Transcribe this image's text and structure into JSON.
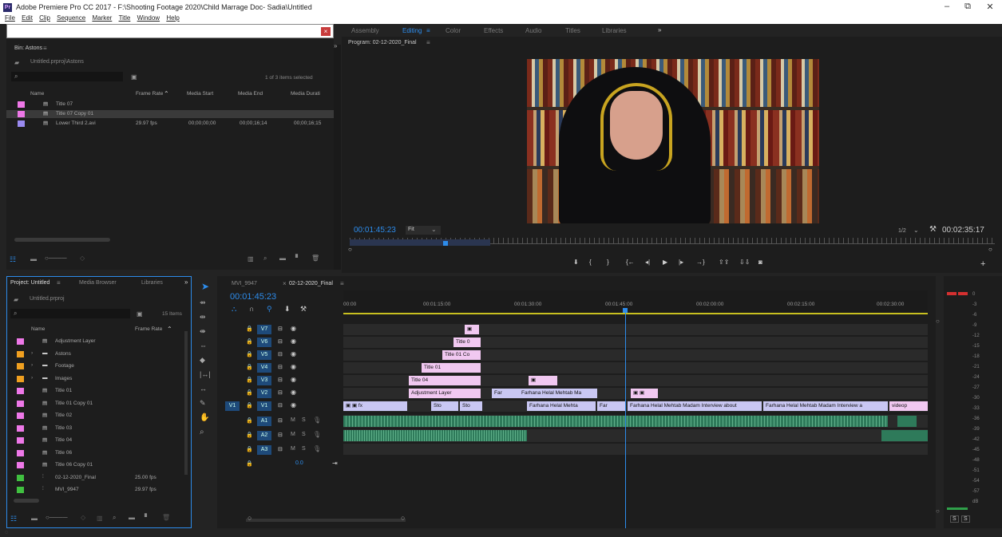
{
  "window": {
    "title": "Adobe Premiere Pro CC 2017 - F:\\Shooting Footage 2020\\Child Marrage Doc- Sadia\\Untitled",
    "minimize": "–",
    "restore": "⧉",
    "close": "✕"
  },
  "menu": [
    "File",
    "Edit",
    "Clip",
    "Sequence",
    "Marker",
    "Title",
    "Window",
    "Help"
  ],
  "workspaces": [
    "Assembly",
    "Editing",
    "Color",
    "Effects",
    "Audio",
    "Titles",
    "Libraries"
  ],
  "workspace_more": "»",
  "bin": {
    "title": "Bin: Astons",
    "path": "Untitled.prproj\\Astons",
    "status": "1 of 3 items selected",
    "columns": [
      "Name",
      "Frame Rate",
      "Media Start",
      "Media End",
      "Media Durati"
    ],
    "items": [
      {
        "name": "Title 07",
        "color": "#ee78e8",
        "fps": "",
        "start": "",
        "end": "",
        "dur": ""
      },
      {
        "name": "Title 07 Copy 01",
        "color": "#ee78e8",
        "fps": "",
        "start": "",
        "end": "",
        "dur": ""
      },
      {
        "name": "Lower Third 2.avi",
        "color": "#9a8af0",
        "fps": "29.97 fps",
        "start": "00;00;00;00",
        "end": "00;00;16;14",
        "dur": "00;00;16;15"
      }
    ]
  },
  "program": {
    "title": "Program: 02-12-2020_Final",
    "timecode": "00:01:45:23",
    "fit": "Fit",
    "resolution": "1/2",
    "duration": "00:02:35:17"
  },
  "project": {
    "tabs": [
      "Project: Untitled",
      "Media Browser",
      "Libraries"
    ],
    "path": "Untitled.prproj",
    "count": "15 Items",
    "columns": [
      "Name",
      "Frame Rate"
    ],
    "items": [
      {
        "name": "Adjustment Layer",
        "color": "#ee78e8",
        "fps": ""
      },
      {
        "name": "Astons",
        "color": "#f0a020",
        "fps": ""
      },
      {
        "name": "Footage",
        "color": "#f0a020",
        "fps": ""
      },
      {
        "name": "Images",
        "color": "#f0a020",
        "fps": ""
      },
      {
        "name": "Title 01",
        "color": "#ee78e8",
        "fps": ""
      },
      {
        "name": "Title 01 Copy 01",
        "color": "#ee78e8",
        "fps": ""
      },
      {
        "name": "Title 02",
        "color": "#ee78e8",
        "fps": ""
      },
      {
        "name": "Title 03",
        "color": "#ee78e8",
        "fps": ""
      },
      {
        "name": "Title 04",
        "color": "#ee78e8",
        "fps": ""
      },
      {
        "name": "Title 06",
        "color": "#ee78e8",
        "fps": ""
      },
      {
        "name": "Title 06 Copy 01",
        "color": "#ee78e8",
        "fps": ""
      },
      {
        "name": "02-12-2020_Final",
        "color": "#40c040",
        "fps": "25.00 fps"
      },
      {
        "name": "MVI_9947",
        "color": "#40c040",
        "fps": "29.97 fps"
      }
    ]
  },
  "timeline": {
    "tabs": [
      "MVI_9947",
      "02-12-2020_Final"
    ],
    "timecode": "00:01:45:23",
    "ruler": [
      "00:00",
      "00:01:15:00",
      "00:01:30:00",
      "00:01:45:00",
      "00:02:00:00",
      "00:02:15:00",
      "00:02:30:00"
    ],
    "video_tracks": [
      "V7",
      "V6",
      "V5",
      "V4",
      "V3",
      "V2",
      "V1"
    ],
    "audio_tracks": [
      "A1",
      "A2",
      "A3"
    ],
    "master": "0.0",
    "clips": {
      "v6": "Title 0",
      "v5": "Title 01 Co",
      "v4": "Title 01",
      "v3": "Title 04",
      "v2a": "Adjustment Layer",
      "v2b": "Far",
      "v2c": "Farhana Helal Mehtab Ma",
      "v1a": "Sto",
      "v1b": "Sto",
      "v1c": "Farhana Helal Mehta",
      "v1d": "Far",
      "v1e": "Farhana Helal Mehtab Madam Interview about",
      "v1f": "Farhana Helal Mehtab Madam Interview a",
      "v1g": "videop"
    }
  },
  "meter": {
    "scale": [
      "0",
      "-3",
      "-6",
      "-9",
      "-12",
      "-15",
      "-18",
      "-21",
      "-24",
      "-27",
      "-30",
      "-33",
      "-36",
      "-39",
      "-42",
      "-45",
      "-48",
      "-51",
      "-54",
      "-57",
      "dB"
    ],
    "solo": [
      "S",
      "S"
    ]
  },
  "colors": {
    "accent": "#2d8ceb",
    "bg": "#232323",
    "panel": "#1d1d1d",
    "pink_clip": "#f1c8f1",
    "lav_clip": "#c9c7f3"
  }
}
